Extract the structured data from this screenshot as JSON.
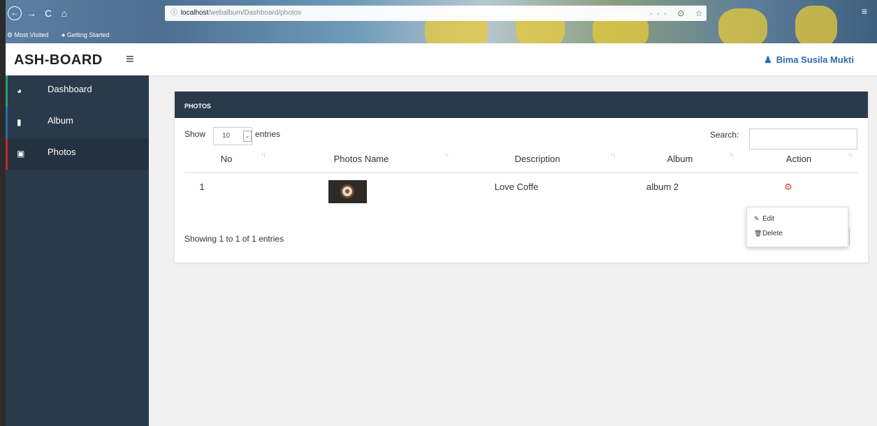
{
  "browser": {
    "url_host": "localhost",
    "url_path": "/webalbum/Dashboard/photos",
    "url_actions": "··· ⊙ ☆",
    "bookmarks": [
      "Most Visited",
      "Getting Started"
    ]
  },
  "header": {
    "brand": "ASH-BOARD",
    "user_name": "Bima Susila Mukti"
  },
  "sidebar": {
    "items": [
      {
        "label": "Dashboard",
        "icon": "dashboard-icon",
        "accent": "#2e9e6a"
      },
      {
        "label": "Album",
        "icon": "file-icon",
        "accent": "#2b6cb0"
      },
      {
        "label": "Photos",
        "icon": "image-icon",
        "accent": "#c62828",
        "active": true
      }
    ]
  },
  "panel": {
    "title": "PHOTOS",
    "show_label": "Show",
    "page_length": "10",
    "entries_label": "entries",
    "search_label": "Search:",
    "columns": [
      "No",
      "Photos Name",
      "Description",
      "Album",
      "Action"
    ],
    "rows": [
      {
        "no": "1",
        "photo": "coffee-thumbnail",
        "description": "Love Coffe",
        "album": "album 2"
      }
    ],
    "info": "Showing 1 to 1 of 1 entries"
  },
  "action_menu": {
    "edit_label": "Edit",
    "delete_label": "Delete"
  },
  "colors": {
    "sidebar_bg": "#2a3a4a",
    "panel_header_bg": "#2a3a4a",
    "user_link": "#2b6cb0",
    "action_icon": "#e53935"
  }
}
